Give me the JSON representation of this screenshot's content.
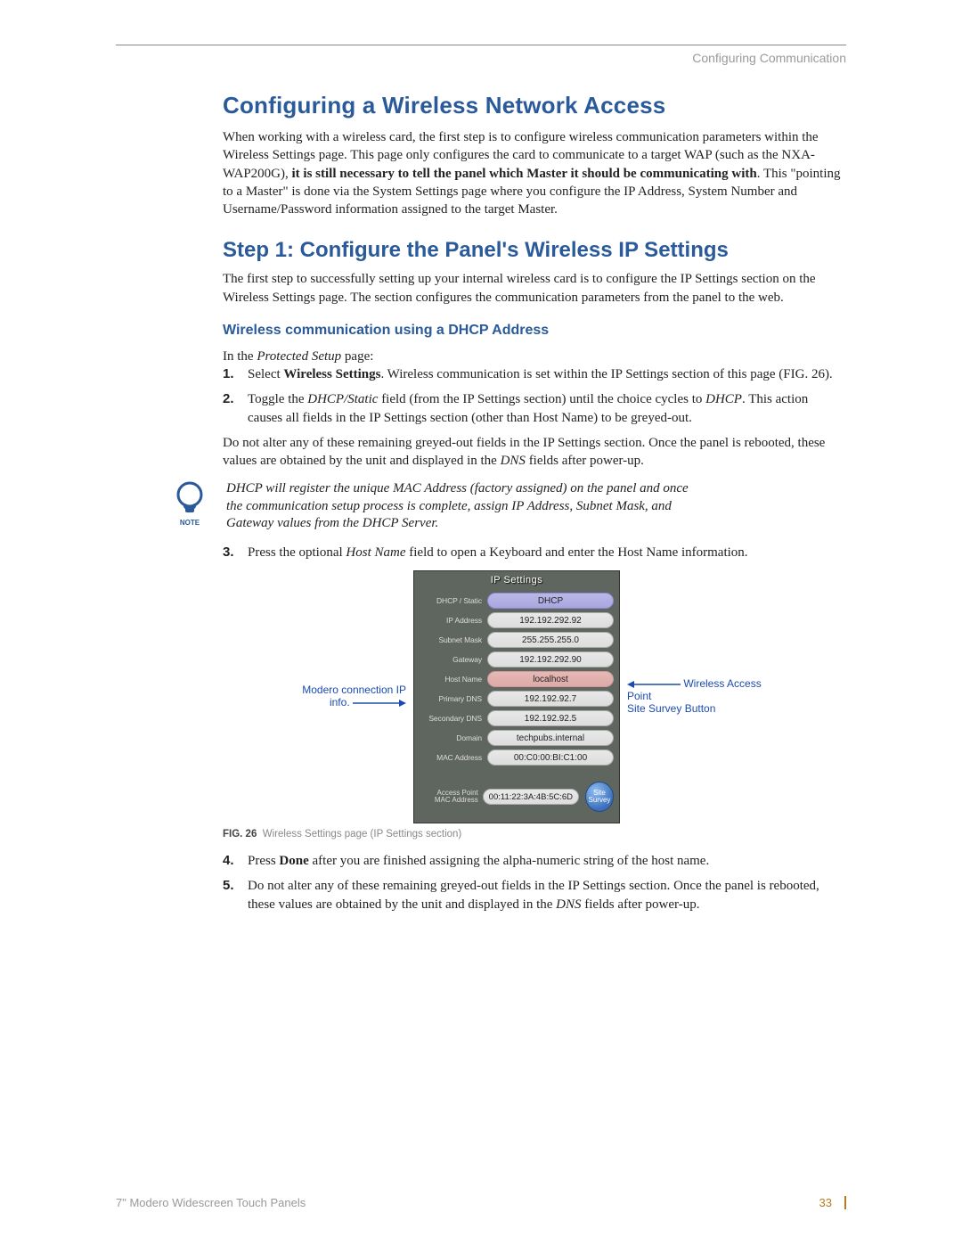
{
  "header": {
    "section": "Configuring Communication"
  },
  "h1": "Configuring a Wireless Network Access",
  "p1_parts": {
    "a": "When working with a wireless card, the first step is to configure wireless communication parameters within the Wireless Settings page. This page only configures the card to communicate to a target WAP (such as the NXA-WAP200G), ",
    "b": "it is still necessary to tell the panel which Master it should be communicating with",
    "c": ". This \"pointing to a Master\" is done via the System Settings page where you configure the IP Address, System Number and Username/Password information assigned to the target Master."
  },
  "h2": "Step 1: Configure the Panel's Wireless IP Settings",
  "p2": "The first step to successfully setting up your internal wireless card is to configure the IP Settings section on the Wireless Settings page. The section configures the communication parameters from the panel to the web.",
  "h3": "Wireless communication using a DHCP Address",
  "p3_a": "In the ",
  "p3_b": "Protected Setup",
  "p3_c": " page:",
  "ol1": {
    "i1_a": "Select ",
    "i1_b": "Wireless Settings",
    "i1_c": ". Wireless communication is set within the IP Settings section of this page (FIG. 26).",
    "i2_a": "Toggle the ",
    "i2_b": "DHCP/Static",
    "i2_c": " field (from the IP Settings section) until the choice cycles to ",
    "i2_d": "DHCP",
    "i2_e": ". This action causes all fields in the IP Settings section (other than Host Name) to be greyed-out."
  },
  "p4_a": "Do not alter any of these remaining greyed-out fields in the IP Settings section. Once the panel is rebooted, these values are obtained by the unit and displayed in the ",
  "p4_b": "DNS",
  "p4_c": " fields after power-up.",
  "note_label": "NOTE",
  "note_text": "DHCP will register the unique MAC Address (factory assigned) on the panel and once the communication setup process is complete, assign IP Address, Subnet Mask, and Gateway values from the DHCP Server.",
  "ol2": {
    "i3_a": "Press the optional ",
    "i3_b": "Host Name",
    "i3_c": " field to open a Keyboard and enter the Host Name information."
  },
  "callouts": {
    "left": "Modero connection IP info.",
    "right_l1": "Wireless Access Point",
    "right_l2": "Site Survey Button"
  },
  "ip_panel": {
    "title": "IP Settings",
    "rows": [
      {
        "label": "DHCP / Static",
        "value": "DHCP",
        "cls": "dhcp"
      },
      {
        "label": "IP Address",
        "value": "192.192.292.92",
        "cls": ""
      },
      {
        "label": "Subnet Mask",
        "value": "255.255.255.0",
        "cls": ""
      },
      {
        "label": "Gateway",
        "value": "192.192.292.90",
        "cls": ""
      },
      {
        "label": "Host Name",
        "value": "localhost",
        "cls": "host"
      },
      {
        "label": "Primary DNS",
        "value": "192.192.92.7",
        "cls": ""
      },
      {
        "label": "Secondary DNS",
        "value": "192.192.92.5",
        "cls": ""
      },
      {
        "label": "Domain",
        "value": "techpubs.internal",
        "cls": ""
      },
      {
        "label": "MAC Address",
        "value": "00:C0:00:BI:C1:00",
        "cls": ""
      }
    ],
    "ap": {
      "label": "Access Point MAC Address",
      "value": "00:11:22:3A:4B:5C:6D",
      "button": "Site Survey"
    }
  },
  "fig": {
    "num": "FIG. 26",
    "caption": "Wireless Settings page (IP Settings section)"
  },
  "ol3": {
    "i4_a": "Press ",
    "i4_b": "Done",
    "i4_c": " after you are finished assigning the alpha-numeric string of the host name.",
    "i5_a": "Do not alter any of these remaining greyed-out fields in the IP Settings section. Once the panel is rebooted, these values are obtained by the unit and displayed in the ",
    "i5_b": "DNS",
    "i5_c": " fields after power-up."
  },
  "footer": {
    "left": "7\" Modero Widescreen Touch Panels",
    "page": "33"
  }
}
